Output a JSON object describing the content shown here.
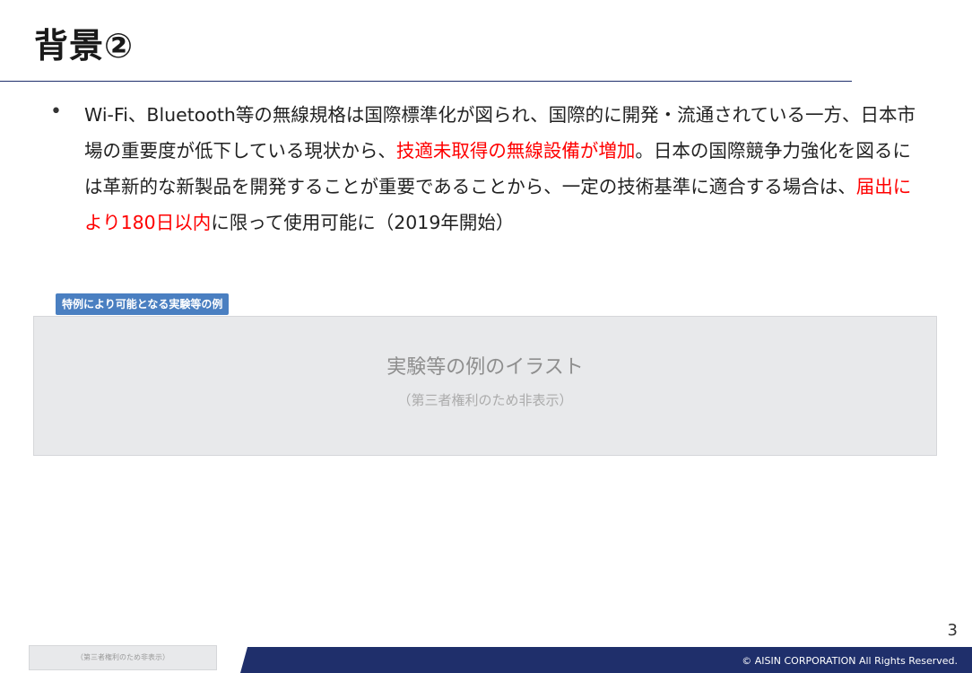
{
  "slide": {
    "title": "背景②",
    "bullet": {
      "marker": "•",
      "segments": [
        {
          "text": "Wi-Fi、Bluetooth等の無線規格は国際標準化が図られ、国際的に開発・流通されている一方、日本市場の重要度が低下している現状から、",
          "emphasis": false
        },
        {
          "text": "技適未取得の無線設備が増加",
          "emphasis": true
        },
        {
          "text": "。日本の国際競争力強化を図るには革新的な新製品を開発することが重要であることから、一定の技術基準に適合する場合は、",
          "emphasis": false
        },
        {
          "text": "届出により180日以内",
          "emphasis": true
        },
        {
          "text": "に限って使用可能に（2019年開始）",
          "emphasis": false
        }
      ]
    },
    "tag_label": "特例により可能となる実験等の例",
    "placeholder": {
      "main": "実験等の例のイラスト",
      "sub": "（第三者権利のため非表示）"
    },
    "small_placeholder": "（第三者権利のため非表示）",
    "page_number": "3",
    "copyright": "© AISIN CORPORATION All Rights Reserved."
  },
  "colors": {
    "accent_navy": "#1f2f6b",
    "emphasis_red": "#ff0000",
    "tag_blue": "#4a7fc1"
  }
}
